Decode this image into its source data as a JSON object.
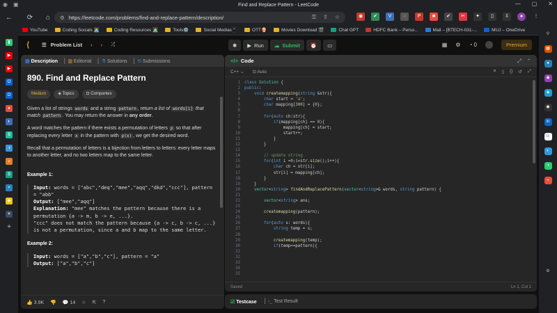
{
  "window": {
    "title": "Find and Replace Pattern - LeetCode"
  },
  "browser": {
    "url": "https://leetcode.com/problems/find-and-replace-pattern/description/",
    "bookmarks": [
      "YouTube",
      "Coding Socials 👨‍💻",
      "Coding Resources 👩‍💻",
      "Tools⚙️",
      "Social Medias📱",
      "OTT🍿",
      "Movies Download 🎬",
      "Chat GPT",
      "HDFC Bank – Perso...",
      "Mail – [BTECH-031-...",
      "MUJ – OneDrive"
    ]
  },
  "app": {
    "problem_list": "Problem List",
    "run": "Run",
    "submit": "Submit",
    "coins": "0",
    "premium": "Premium"
  },
  "desc": {
    "tabs": [
      "Description",
      "Editorial",
      "Solutions",
      "Submissions"
    ],
    "title": "890. Find and Replace Pattern",
    "difficulty": "Medium",
    "topics": "Topics",
    "companies": "Companies",
    "p1_a": "Given a list of strings ",
    "p1_code1": "words",
    "p1_b": " and a string ",
    "p1_code2": "pattern",
    "p1_c": ", return ",
    "p1_d": "a list of ",
    "p1_code3": "words[i]",
    "p1_e": " that match ",
    "p1_code4": "pattern",
    "p1_f": ". You may return the answer in ",
    "p1_g": "any order",
    "p1_h": ".",
    "p2_a": "A word matches the pattern if there exists a permutation of letters ",
    "p2_code1": "p",
    "p2_b": " so that after replacing every letter ",
    "p2_code2": "x",
    "p2_c": " in the pattern with ",
    "p2_code3": "p(x)",
    "p2_d": ", we get the desired word.",
    "p3": "Recall that a permutation of letters is a bijection from letters to letters: every letter maps to another letter, and no two letters map to the same letter.",
    "ex1_title": "Example 1:",
    "ex1_input_label": "Input:",
    "ex1_input": " words = [\"abc\",\"deq\",\"mee\",\"aqq\",\"dkd\",\"ccc\"], pattern = \"abb\"",
    "ex1_output_label": "Output:",
    "ex1_output": " [\"mee\",\"aqq\"]",
    "ex1_expl_label": "Explanation:",
    "ex1_expl": " \"mee\" matches the pattern because there is a permutation {a -> m, b -> e, ...}.\n\"ccc\" does not match the pattern because {a -> c, b -> c, ...} is not a permutation, since a and b map to the same letter.",
    "ex2_title": "Example 2:",
    "ex2_input_label": "Input:",
    "ex2_input": " words = [\"a\",\"b\",\"c\"], pattern = \"a\"",
    "ex2_output_label": "Output:",
    "ex2_output": " [\"a\",\"b\",\"c\"]",
    "likes": "3.9K",
    "comments": "14"
  },
  "code": {
    "title": "Code",
    "lang": "C++",
    "auto": "Auto",
    "status_left": "Saved",
    "status_right": "Ln 1, Col 1",
    "line_numbers": [
      "1",
      "2",
      "3",
      "4",
      "5",
      "6",
      "7",
      "8",
      "9",
      "10",
      "11",
      "12",
      "13",
      "14",
      "15",
      "16",
      "17",
      "18",
      "19",
      "20",
      "21",
      "22",
      "23",
      "24",
      "25",
      "26",
      "27",
      "28",
      "29",
      "30",
      "31",
      "32",
      "33",
      "34",
      "35"
    ]
  },
  "test": {
    "tabs": [
      "Testcase",
      "Test Result"
    ]
  }
}
